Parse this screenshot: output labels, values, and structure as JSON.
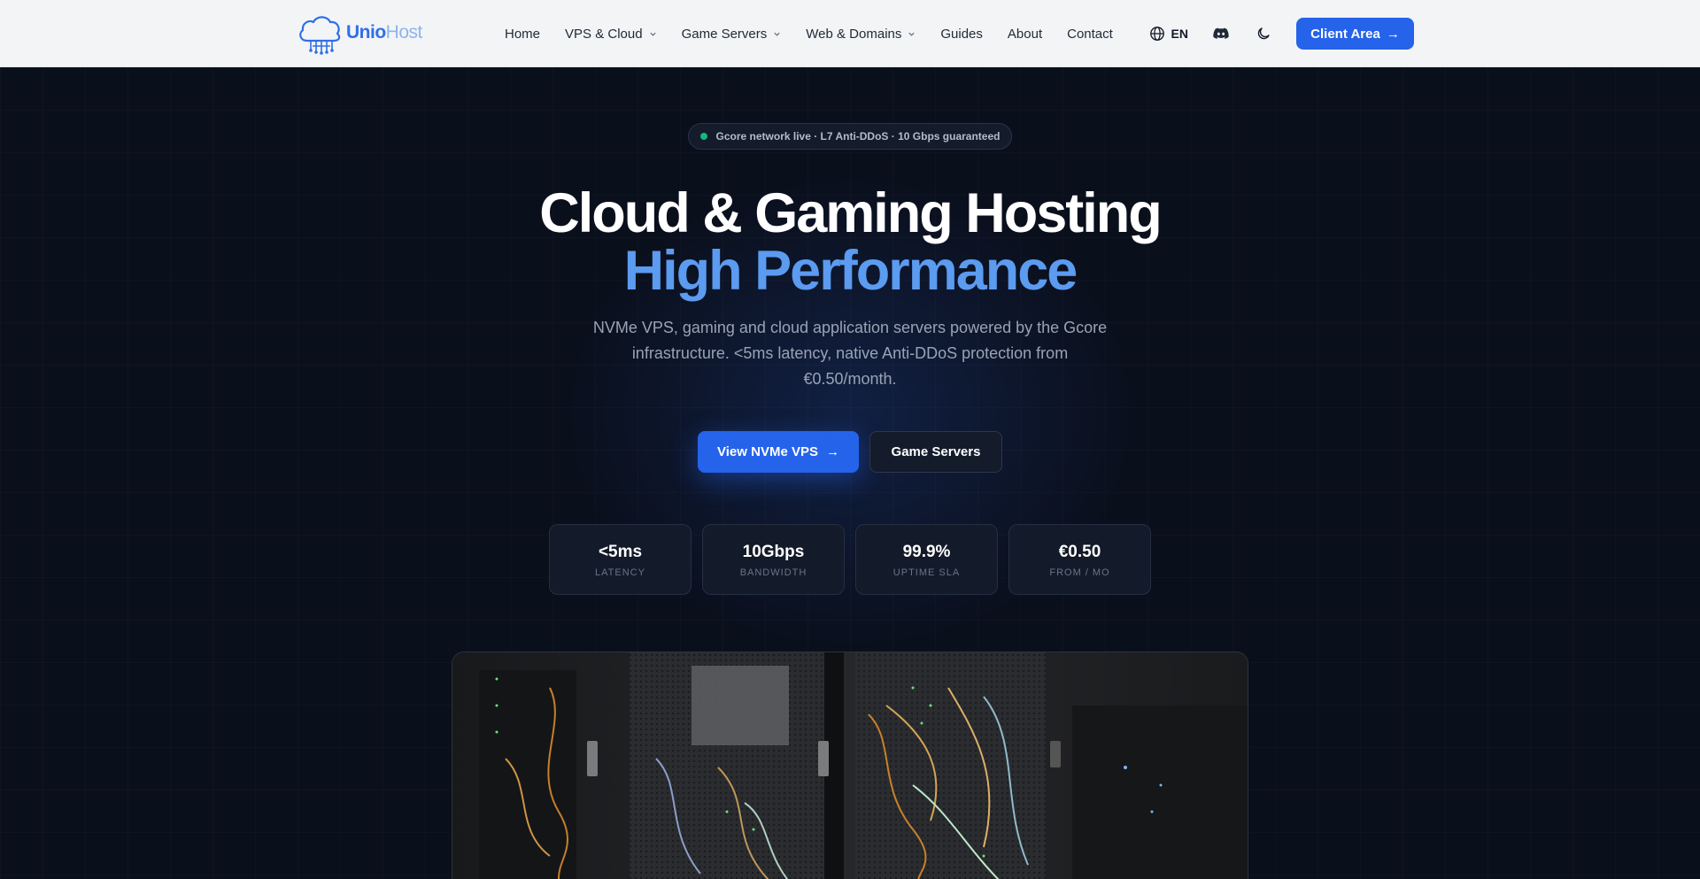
{
  "brand": {
    "name_part1": "Unio",
    "name_part2": "Host"
  },
  "nav": {
    "items": [
      {
        "label": "Home",
        "has_dropdown": false
      },
      {
        "label": "VPS & Cloud",
        "has_dropdown": true
      },
      {
        "label": "Game Servers",
        "has_dropdown": true
      },
      {
        "label": "Web & Domains",
        "has_dropdown": true
      },
      {
        "label": "Guides",
        "has_dropdown": false
      },
      {
        "label": "About",
        "has_dropdown": false
      },
      {
        "label": "Contact",
        "has_dropdown": false
      }
    ],
    "language": "EN",
    "client_area_label": "Client Area"
  },
  "hero": {
    "status_pill": "Gcore network live · L7 Anti-DDoS · 10 Gbps guaranteed",
    "title_line1": "Cloud & Gaming Hosting",
    "title_line2": "High Performance",
    "subtitle": "NVMe VPS, gaming and cloud application servers powered by the Gcore infrastructure. <5ms latency, native Anti-DDoS protection from €0.50/month.",
    "primary_cta": "View NVMe VPS",
    "secondary_cta": "Game Servers",
    "stats": [
      {
        "value": "<5ms",
        "label": "LATENCY"
      },
      {
        "value": "10Gbps",
        "label": "BANDWIDTH"
      },
      {
        "value": "99.9%",
        "label": "UPTIME SLA"
      },
      {
        "value": "€0.50",
        "label": "FROM / MO"
      }
    ]
  },
  "colors": {
    "accent": "#2563eb",
    "accent_light": "#5b9bf0",
    "status_live": "#10b981",
    "hero_bg": "#0a0f1c",
    "nav_bg": "#f3f4f6"
  },
  "icons": {
    "logo": "cloud-network-icon",
    "language": "globe-icon",
    "community": "discord-icon",
    "theme": "moon-icon",
    "arrow": "arrow-right-icon",
    "dropdown": "chevron-down-icon"
  }
}
